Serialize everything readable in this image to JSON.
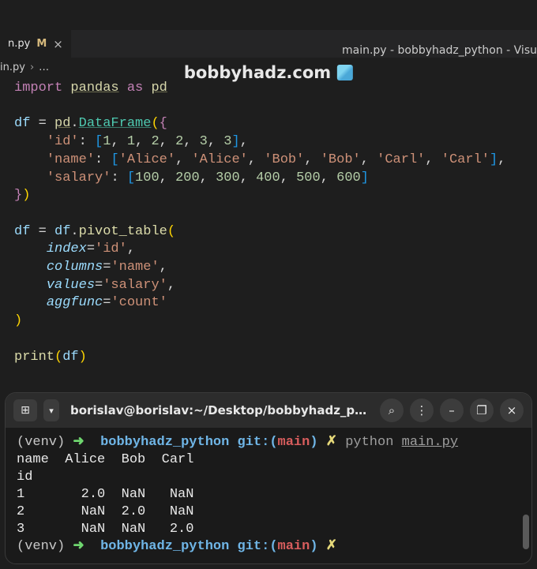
{
  "window": {
    "title": "main.py - bobbyhadz_python - Visu"
  },
  "watermark": {
    "text": "bobbyhadz.com"
  },
  "tab": {
    "file": "n.py",
    "modified": "M",
    "close": "×"
  },
  "breadcrumb": {
    "file": "in.py",
    "more": "…"
  },
  "code": {
    "l1_import": "import",
    "l1_pandas": "pandas",
    "l1_as": "as",
    "l1_pd": "pd",
    "l3_df": "df",
    "l3_eq": "=",
    "l3_pd": "pd",
    "l3_dot": ".",
    "l3_DataFrame": "DataFrame",
    "l4_id": "'id'",
    "l4_vals": [
      "1",
      "1",
      "2",
      "2",
      "3",
      "3"
    ],
    "l5_name": "'name'",
    "l5_vals": [
      "'Alice'",
      "'Alice'",
      "'Bob'",
      "'Bob'",
      "'Carl'",
      "'Carl'"
    ],
    "l6_salary": "'salary'",
    "l6_vals": [
      "100",
      "200",
      "300",
      "400",
      "500",
      "600"
    ],
    "l8_df": "df",
    "l8_eq": "=",
    "l8_df2": "df",
    "l8_pivot": "pivot_table",
    "l9_index": "index",
    "l9_val": "'id'",
    "l10_columns": "columns",
    "l10_val": "'name'",
    "l11_values": "values",
    "l11_val": "'salary'",
    "l12_aggfunc": "aggfunc",
    "l12_val": "'count'",
    "l14_print": "print",
    "l14_df": "df"
  },
  "terminal": {
    "title": "borislav@borislav:~/Desktop/bobbyhadz_pyt…",
    "newtab_icon": "⊞",
    "drop_icon": "▾",
    "search_icon": "⌕",
    "menu_icon": "⋮",
    "min_icon": "–",
    "max_icon": "❐",
    "close_icon": "×",
    "prompt": {
      "venv": "(venv)",
      "arrow": "➜",
      "dir": "bobbyhadz_python",
      "git": "git:",
      "lp": "(",
      "branch": "main",
      "rp": ")",
      "x": "✗",
      "cmd": "python",
      "file": "main.py"
    },
    "out1": "name  Alice  Bob  Carl",
    "out2": "id                    ",
    "out3": "1       2.0  NaN   NaN",
    "out4": "2       NaN  2.0   NaN",
    "out5": "3       NaN  NaN   2.0"
  }
}
